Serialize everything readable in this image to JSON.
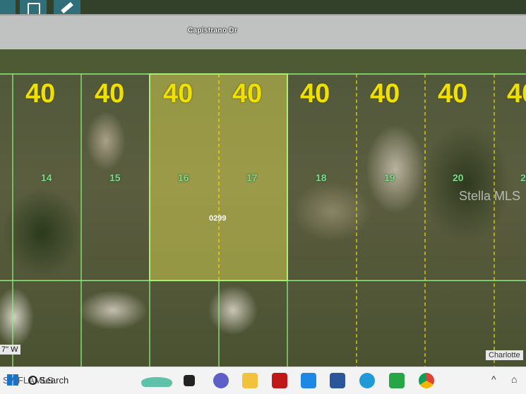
{
  "map": {
    "street_name": "Capistrano Dr",
    "lot_width_label": "40",
    "lots": [
      "14",
      "15",
      "16",
      "17",
      "18",
      "19",
      "20",
      "2"
    ],
    "parcel_id": "0299",
    "watermark": "Stella MLS",
    "coordinate_fragment": "7\" W",
    "county_fragment": "Charlotte",
    "colors": {
      "lot_lines": "#8cf07a",
      "selected_parcel": "#f2ef55",
      "lot_width": "#f0e000",
      "lot_number": "#7fd88a"
    }
  },
  "taskbar": {
    "search_label": "Search",
    "overlay_text": "SWFLAMLS",
    "app_icons": [
      "widgets-icon",
      "file-explorer-icon",
      "teams-icon",
      "folder-icon",
      "mcafee-icon",
      "store-icon",
      "mail-icon",
      "edge-icon",
      "chart-icon",
      "chrome-icon"
    ],
    "tray": {
      "chevron": "^",
      "more": "⌂"
    }
  }
}
